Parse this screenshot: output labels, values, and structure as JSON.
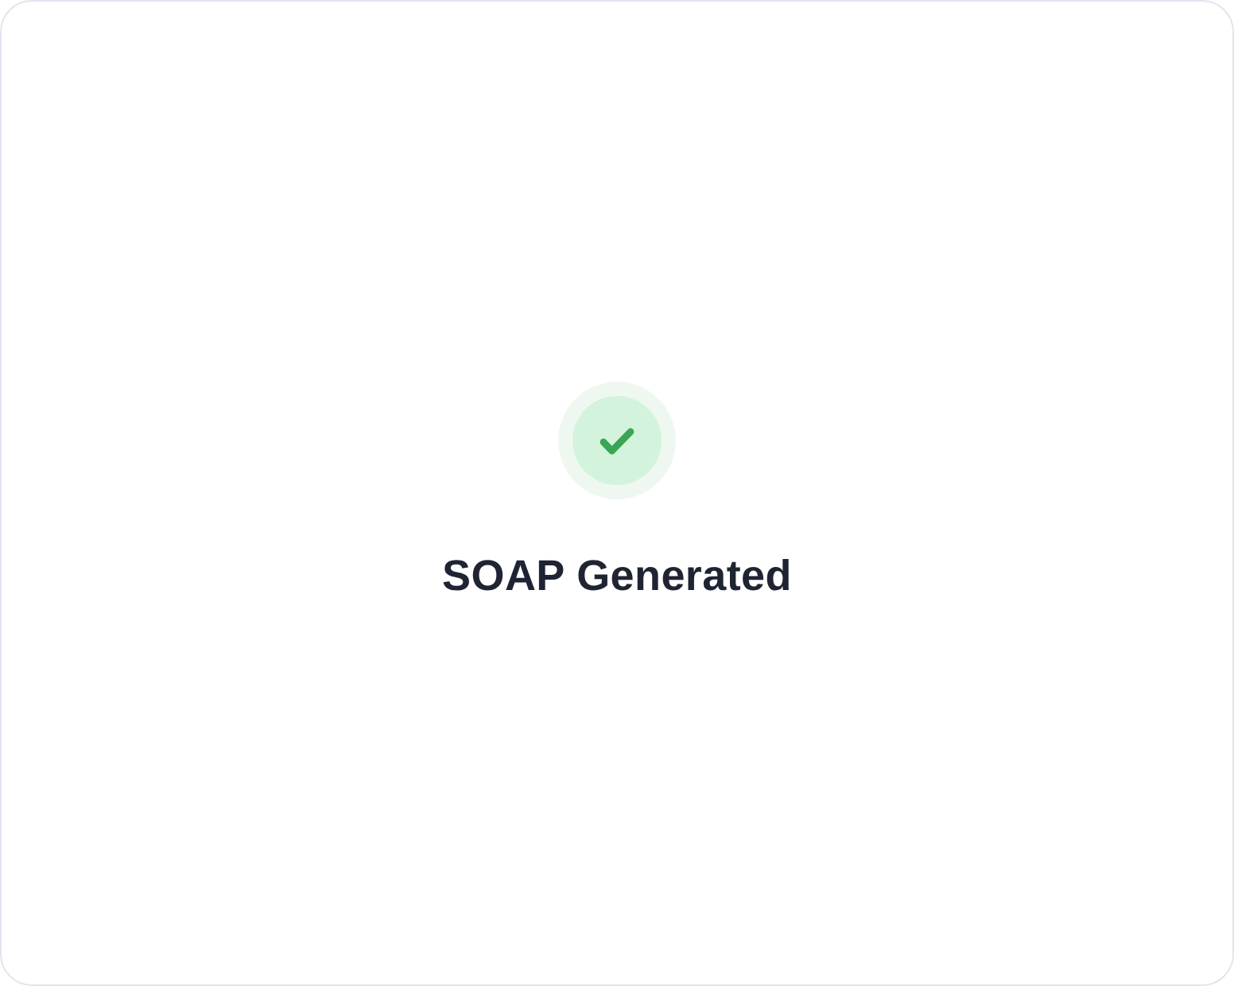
{
  "card": {
    "kind": "success",
    "title": "SOAP Generated"
  }
}
